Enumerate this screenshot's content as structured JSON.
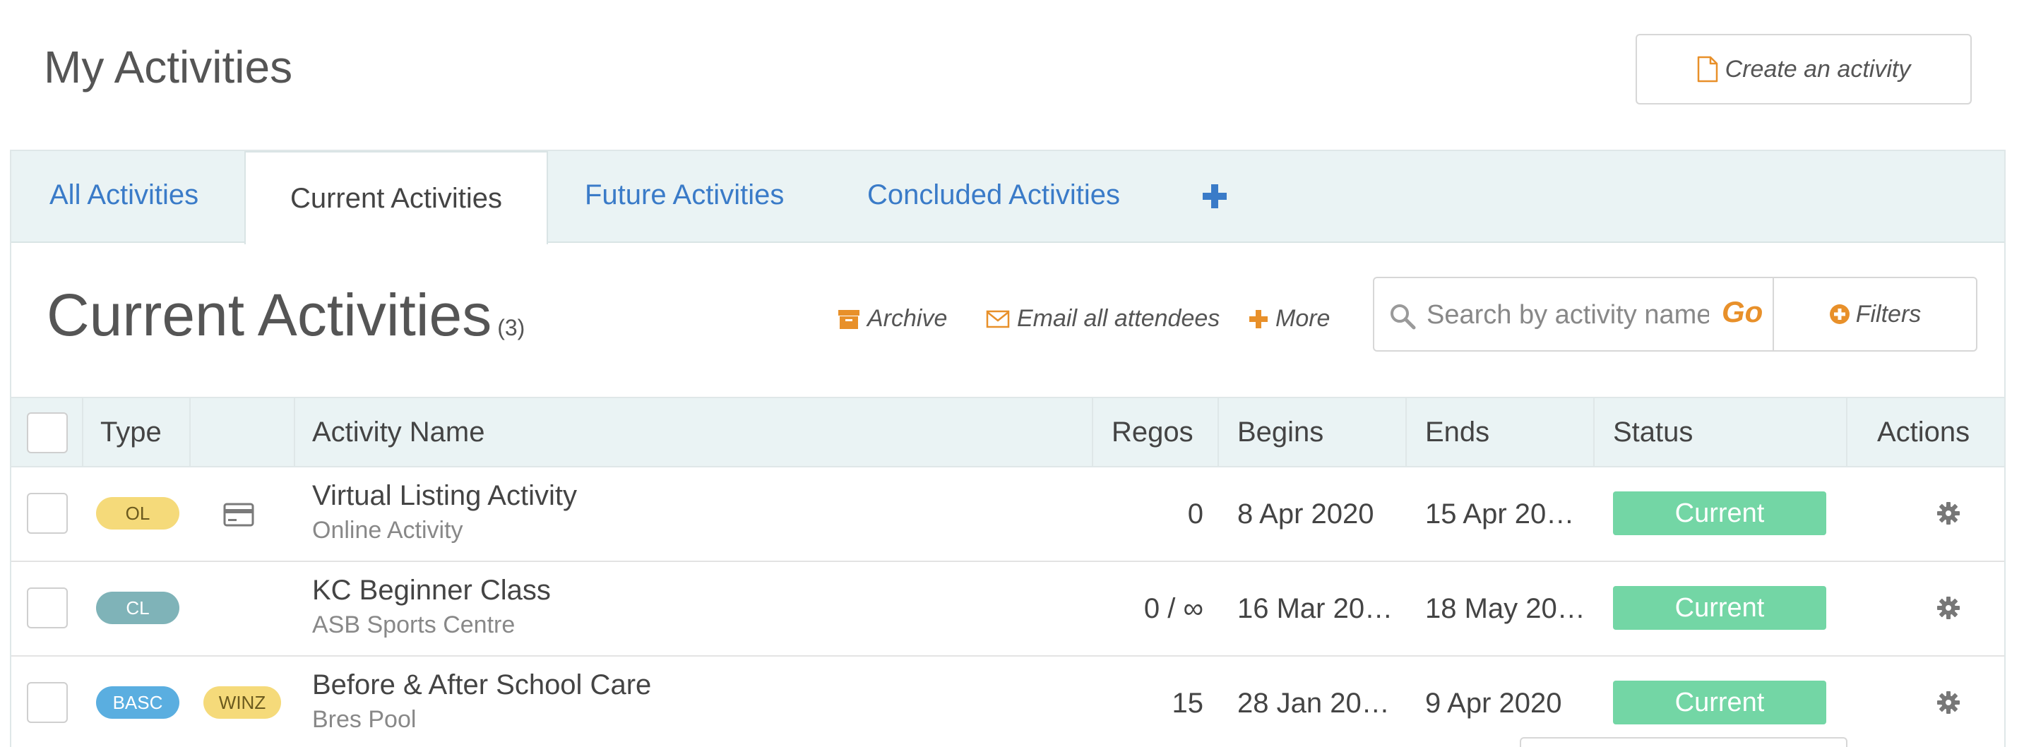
{
  "page": {
    "title": "My Activities",
    "create_button_label": "Create an activity"
  },
  "tabs": [
    {
      "label": "All Activities"
    },
    {
      "label": "Current Activities",
      "active": true
    },
    {
      "label": "Future Activities"
    },
    {
      "label": "Concluded Activities"
    }
  ],
  "section": {
    "title": "Current Activities",
    "count": "(3)"
  },
  "toolbar": {
    "archive": "Archive",
    "email": "Email all attendees",
    "more": "More"
  },
  "search": {
    "placeholder": "Search by activity name",
    "go": "Go",
    "filters": "Filters"
  },
  "table": {
    "headers": {
      "type": "Type",
      "name": "Activity Name",
      "regos": "Regos",
      "begins": "Begins",
      "ends": "Ends",
      "status": "Status",
      "actions": "Actions"
    },
    "rows": [
      {
        "type": "OL",
        "type_color": "#f5da7a",
        "has_card_icon": true,
        "name": "Virtual Listing Activity",
        "location": "Online Activity",
        "regos": "0",
        "begins": "8 Apr 2020",
        "ends": "15 Apr 20…",
        "status": "Current"
      },
      {
        "type": "CL",
        "type_color": "#7fb3b8",
        "name": "KC Beginner Class",
        "location": "ASB Sports Centre",
        "regos": "0 / ∞",
        "begins": "16 Mar 20…",
        "ends": "18 May 20…",
        "status": "Current"
      },
      {
        "type": "BASC",
        "type_color": "#5aaee0",
        "extra_badge": "WINZ",
        "extra_badge_color": "#f5da7a",
        "name": "Before & After School Care",
        "location": "Bres Pool",
        "regos": "15",
        "begins": "28 Jan 20…",
        "ends": "9 Apr 2020",
        "status": "Current"
      }
    ]
  },
  "colors": {
    "accent_orange": "#e8902a",
    "link_blue": "#3a7bc8",
    "status_green": "#73d6a5",
    "header_bg": "#eaf3f4"
  }
}
